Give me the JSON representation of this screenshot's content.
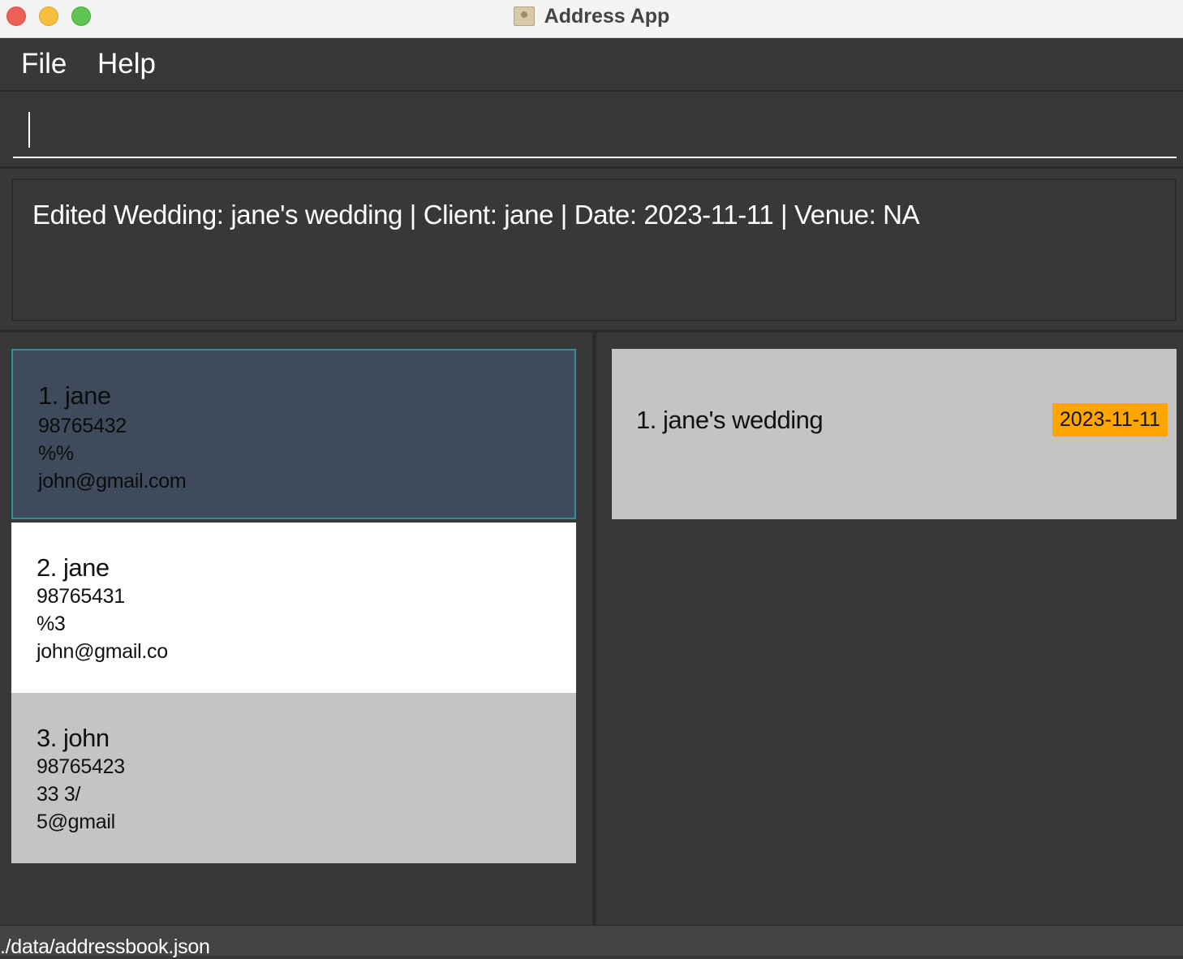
{
  "window": {
    "title": "Address App"
  },
  "menu": {
    "file": "File",
    "help": "Help"
  },
  "command": {
    "value": "",
    "placeholder": ""
  },
  "result": {
    "text": "Edited Wedding: jane's wedding | Client: jane | Date: 2023-11-11 | Venue: NA"
  },
  "persons": [
    {
      "name": "1. jane",
      "phone": "98765432",
      "address": "%%",
      "email": "john@gmail.com"
    },
    {
      "name": "2. jane",
      "phone": "98765431",
      "address": "%3",
      "email": "john@gmail.co"
    },
    {
      "name": "3. john",
      "phone": "98765423",
      "address": "33  3/",
      "email": "5@gmail"
    }
  ],
  "weddings": [
    {
      "name": "1. jane's wedding",
      "date": "2023-11-11"
    }
  ],
  "status": {
    "path": "./data/addressbook.json"
  },
  "colors": {
    "background": "#383838",
    "selected_card": "#3f4b5d",
    "date_badge": "#ffa500"
  }
}
